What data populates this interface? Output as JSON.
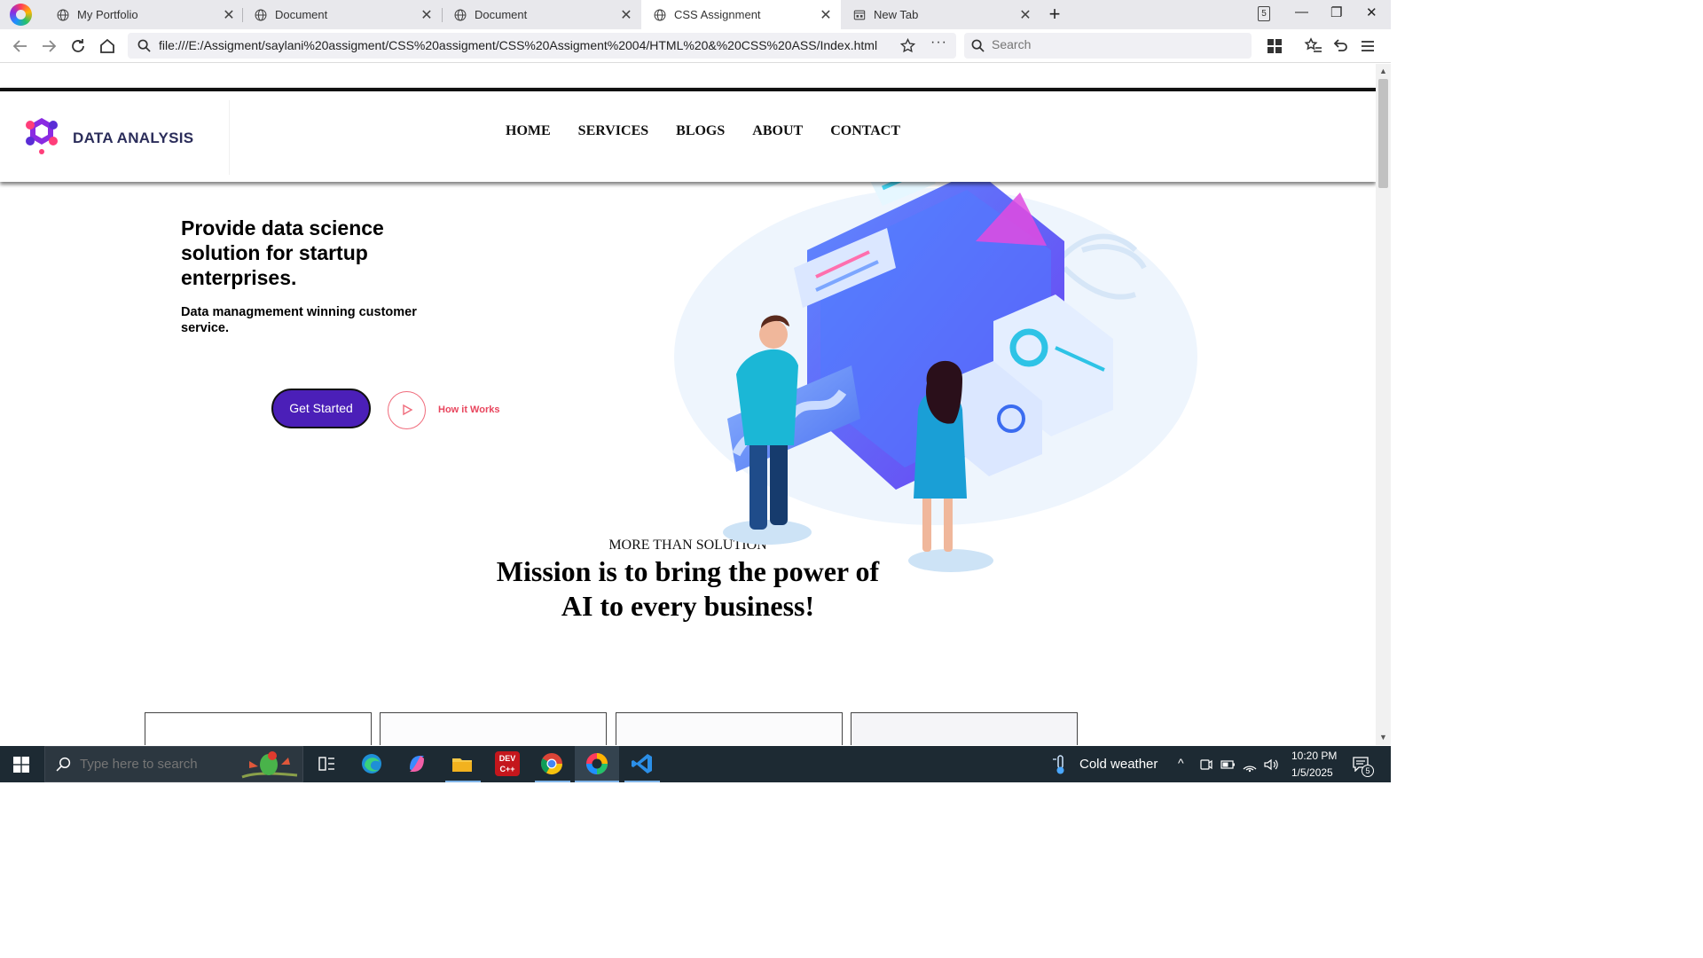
{
  "browser": {
    "tabs": [
      {
        "label": "My Portfolio",
        "active": false
      },
      {
        "label": "Document",
        "active": false
      },
      {
        "label": "Document",
        "active": false
      },
      {
        "label": "CSS Assignment",
        "active": true
      },
      {
        "label": "New Tab",
        "active": false
      }
    ],
    "tab_count": "5",
    "url": "file:///E:/Assigment/saylani%20assigment/CSS%20assigment/CSS%20Assigment%2004/HTML%20&%20CSS%20ASS/Index.html",
    "search_placeholder": "Search"
  },
  "site": {
    "brand": "DATA ANALYSIS",
    "nav": [
      "HOME",
      "SERVICES",
      "BLOGS",
      "ABOUT",
      "CONTACT"
    ],
    "hero": {
      "title": "Provide data science solution for startup enterprises.",
      "subtitle": "Data managmement winning customer service.",
      "cta_primary": "Get Started",
      "cta_secondary": "How it Works"
    },
    "mission": {
      "kicker": "MORE THAN SOLUTION",
      "heading": "Mission is to bring the power of AI to every business!"
    }
  },
  "taskbar": {
    "search_placeholder": "Type here to search",
    "weather": "Cold weather",
    "time": "10:20 PM",
    "date": "1/5/2025",
    "notification_count": "5"
  },
  "colors": {
    "primary_button": "#4b1fb8",
    "how_link": "#e8455d",
    "brand_text": "#2b2d5a"
  }
}
